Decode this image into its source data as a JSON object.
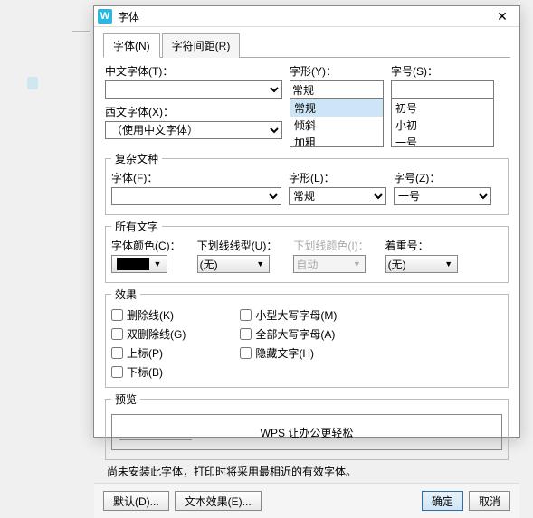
{
  "window": {
    "title": "字体"
  },
  "tabs": {
    "t0": "字体(N)",
    "t1": "字符间距(R)"
  },
  "cn": {
    "label": "中文字体(T)：",
    "value": ""
  },
  "en": {
    "label": "西文字体(X)：",
    "value": "（使用中文字体）"
  },
  "style": {
    "label": "字形(Y)：",
    "value": "常规",
    "options": {
      "o0": "常规",
      "o1": "倾斜",
      "o2": "加粗"
    }
  },
  "size": {
    "label": "字号(S)：",
    "value": "",
    "options": {
      "o0": "初号",
      "o1": "小初",
      "o2": "一号"
    }
  },
  "complex": {
    "legend": "复杂文种",
    "font_label": "字体(F)：",
    "font_value": "",
    "style_label": "字形(L)：",
    "style_value": "常规",
    "size_label": "字号(Z)：",
    "size_value": "一号"
  },
  "alltext": {
    "legend": "所有文字",
    "color_label": "字体颜色(C)：",
    "color_value": "#000000",
    "ul_style_label": "下划线线型(U)：",
    "ul_style_value": "(无)",
    "ul_color_label": "下划线颜色(I)：",
    "ul_color_value": "自动",
    "emph_label": "着重号：",
    "emph_value": "(无)"
  },
  "effects": {
    "legend": "效果",
    "strike": "删除线(K)",
    "dstrike": "双删除线(G)",
    "super": "上标(P)",
    "sub": "下标(B)",
    "smallcaps": "小型大写字母(M)",
    "allcaps": "全部大写字母(A)",
    "hidden": "隐藏文字(H)"
  },
  "preview": {
    "legend": "预览",
    "sample": "WPS 让办公更轻松"
  },
  "note": "尚未安装此字体，打印时将采用最相近的有效字体。",
  "footer": {
    "default": "默认(D)...",
    "texteffect": "文本效果(E)...",
    "ok": "确定",
    "cancel": "取消"
  }
}
